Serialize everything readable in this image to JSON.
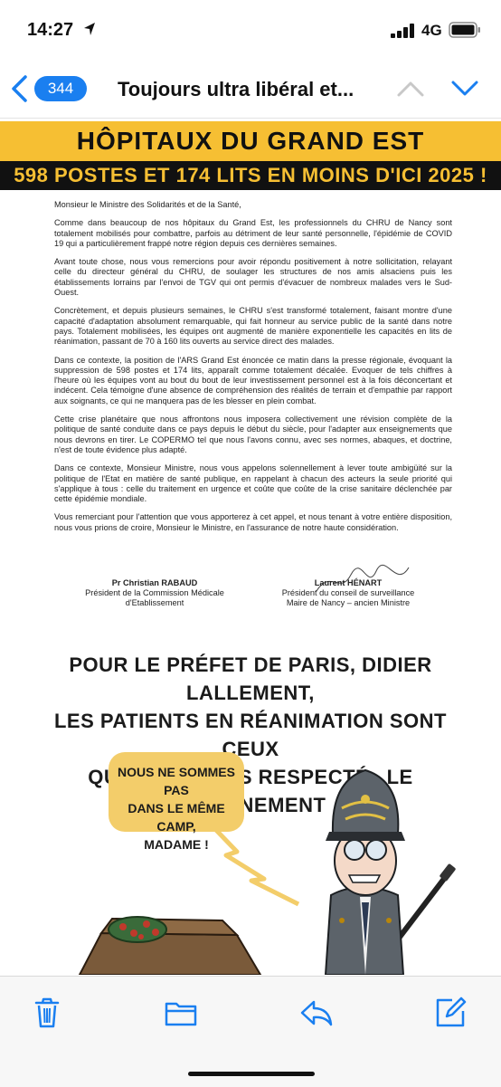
{
  "status_bar": {
    "time": "14:27",
    "network": "4G",
    "icons": [
      "location-arrow-icon",
      "signal-icon",
      "battery-icon"
    ]
  },
  "nav": {
    "badge_count": "344",
    "title": "Toujours ultra libéral et...",
    "icons": [
      "chevron-left-icon",
      "chevron-up-icon",
      "chevron-down-icon"
    ],
    "accent_color": "#1a7ff0"
  },
  "attachment": {
    "banner": {
      "title": "HÔPITAUX DU GRAND EST",
      "subtitle": "598 POSTES ET 174 LITS EN MOINS D'ICI 2025 !",
      "colors": {
        "yellow": "#f6bf33",
        "black": "#111111"
      }
    },
    "letter": {
      "salutation": "Monsieur le Ministre des Solidarités et de la Santé,",
      "paragraphs": [
        "Comme dans beaucoup de nos hôpitaux du Grand Est, les professionnels du CHRU de Nancy sont totalement mobilisés pour combattre, parfois au détriment de leur santé personnelle, l'épidémie de COVID 19 qui a particulièrement frappé notre région depuis ces dernières semaines.",
        "Avant toute chose, nous vous remercions pour avoir répondu positivement à notre sollicitation, relayant celle du directeur général du CHRU, de soulager les structures de nos amis alsaciens puis les établissements lorrains par l'envoi de TGV qui ont permis d'évacuer de nombreux malades vers le Sud-Ouest.",
        "Concrètement, et depuis plusieurs semaines, le CHRU s'est transformé totalement, faisant montre d'une capacité d'adaptation absolument remarquable, qui fait honneur au service public de la santé dans notre pays. Totalement mobilisées, les équipes ont augmenté de manière exponentielle les capacités en lits de réanimation, passant de 70 à 160 lits ouverts au service direct des malades.",
        "Dans ce contexte, la position de l'ARS Grand Est énoncée ce matin dans la presse régionale, évoquant la suppression de 598 postes et 174 lits, apparaît comme totalement décalée. Evoquer de tels chiffres à l'heure où les équipes vont au bout du bout de leur investissement personnel est à la fois déconcertant et indécent. Cela témoigne d'une absence de compréhension des réalités de terrain et d'empathie par rapport aux soignants, ce qui ne manquera pas de les blesser en plein combat.",
        "Cette crise planétaire que nous affrontons nous imposera collectivement une révision complète de la politique de santé conduite dans ce pays depuis le début du siècle, pour l'adapter aux enseignements que nous devrons en tirer. Le COPERMO tel que nous l'avons connu, avec ses normes, abaques, et doctrine, n'est de toute évidence plus adapté.",
        "Dans ce contexte, Monsieur Ministre, nous vous appelons solennellement à lever toute ambigüité sur la politique de l'Etat en matière de santé publique, en rappelant à chacun des acteurs la seule priorité qui s'applique à tous : celle du traitement en urgence et coûte que coûte de la crise sanitaire déclenchée par cette épidémie mondiale.",
        "Vous remerciant pour l'attention que vous apporterez à cet appel, et nous tenant à votre entière disposition, nous vous prions de croire, Monsieur le Ministre, en l'assurance de notre haute considération."
      ],
      "signatures": [
        {
          "name": "Pr Christian RABAUD",
          "role_line1": "Président de la Commission Médicale",
          "role_line2": "d'Etablissement"
        },
        {
          "name": "Laurent HÉNART",
          "role_line1": "Président du conseil de surveillance",
          "role_line2": "Maire de Nancy – ancien Ministre"
        }
      ]
    },
    "comic": {
      "caption_lines": [
        "POUR LE PRÉFET DE PARIS, DIDIER LALLEMENT,",
        "LES PATIENTS EN RÉANIMATION SONT CEUX",
        "QUI N'ONT «PAS RESPECTÉ» LE CONFINEMENT"
      ],
      "bubble_lines": [
        "NOUS NE SOMMES PAS",
        "DANS LE MÊME CAMP,",
        "MADAME !"
      ],
      "bubble_color": "#f3cd6a"
    }
  },
  "toolbar": {
    "icons": [
      "trash-icon",
      "folder-icon",
      "reply-icon",
      "compose-icon"
    ],
    "color": "#1a7ff0"
  }
}
